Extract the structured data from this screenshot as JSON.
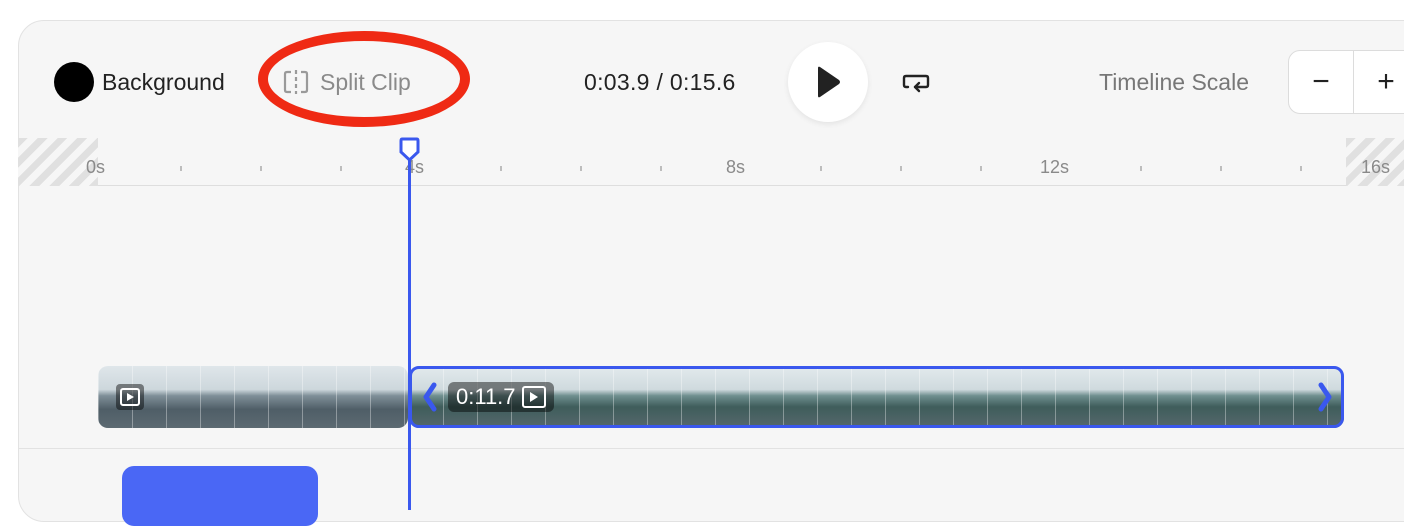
{
  "toolbar": {
    "background_label": "Background",
    "background_color": "#000000",
    "split_clip_label": "Split Clip",
    "current_time": "0:03.9",
    "separator": "/",
    "total_time": "0:15.6",
    "timeline_scale_label": "Timeline Scale",
    "zoom_out_label": "−",
    "zoom_in_label": "+"
  },
  "ruler": {
    "labels": [
      "0s",
      "4s",
      "8s",
      "12s",
      "16s"
    ]
  },
  "tracks": {
    "clip2_duration": "0:11.7"
  },
  "colors": {
    "accent": "#3a58ee",
    "annotation": "#ef2a14",
    "block": "#4a67f5"
  },
  "icons": [
    "split-clip-icon",
    "play-icon",
    "loop-icon",
    "video-clip-icon",
    "trim-handle-left-icon",
    "trim-handle-right-icon"
  ]
}
